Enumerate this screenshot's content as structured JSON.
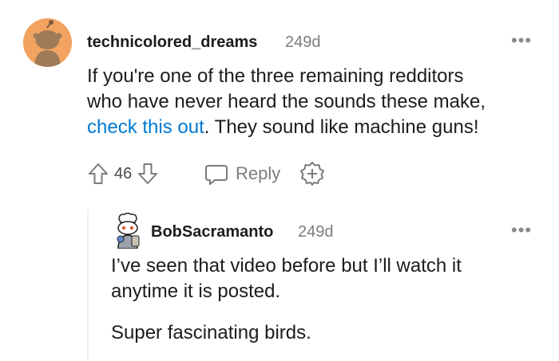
{
  "comments": [
    {
      "author": "technicolored_dreams",
      "age": "249d",
      "body_part1": "If you're one of the three remaining redditors",
      "body_part2": "who have never heard the sounds these make,",
      "body_link": "check this out",
      "body_part3": ". They sound like machine guns!",
      "votes": "46",
      "reply_label": "Reply",
      "avatar_color": "#f2a35f"
    },
    {
      "author": "BobSacramanto",
      "age": "249d",
      "body_line1": "I’ve seen that video before but I’ll watch it",
      "body_line2": "anytime it is posted.",
      "body_line3": "Super fascinating birds."
    }
  ],
  "more_label": "•••",
  "colors": {
    "link": "#0079d3",
    "meta": "#7c7c7c",
    "icon": "#787c7e",
    "thread_line": "#edeff1"
  }
}
